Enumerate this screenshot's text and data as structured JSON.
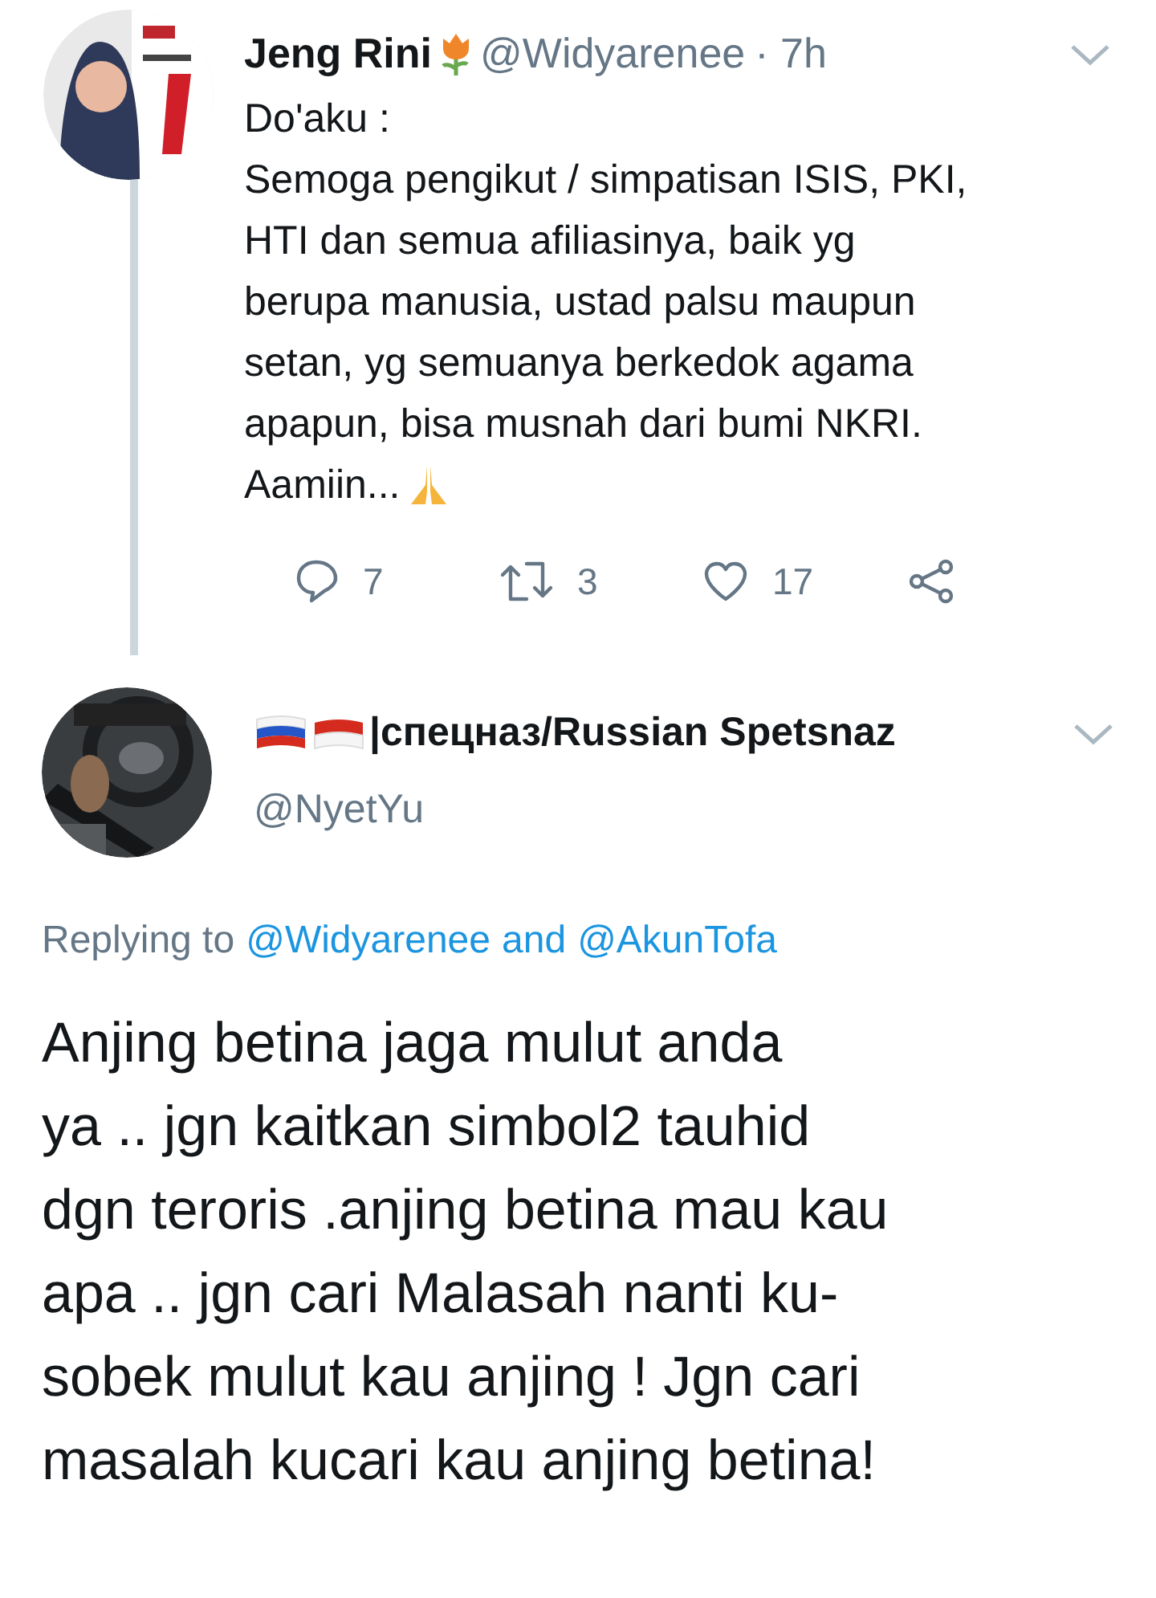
{
  "tweet": {
    "name": "Jeng Rini",
    "handle": "@Widyarenee",
    "time": "· 7h",
    "lines": [
      "Do'aku :",
      "Semoga pengikut / simpatisan ISIS, PKI,",
      "HTI dan semua afiliasinya, baik yg",
      "berupa manusia, ustad palsu maupun",
      "setan, yg semuanya berkedok agama",
      "apapun, bisa musnah dari bumi NKRI.",
      "Aamiin..."
    ],
    "actions": [
      {
        "kind": "reply",
        "count": "7"
      },
      {
        "kind": "retweet",
        "count": "3"
      },
      {
        "kind": "like",
        "count": "17"
      },
      {
        "kind": "share"
      }
    ]
  },
  "reply": {
    "name": "|спецназ/Russian Spetsnaz",
    "handle": "@NyetYu",
    "replying_to": [
      {
        "kind": "text",
        "text": "Replying to"
      },
      {
        "kind": "link",
        "text": "@Widyarenee"
      },
      {
        "kind": "link",
        "text": "and"
      },
      {
        "kind": "link",
        "text": "@AkunTofa"
      }
    ],
    "lines": [
      "Anjing betina jaga mulut anda",
      "ya .. jgn kaitkan simbol2 tauhid",
      "dgn teroris .anjing betina mau kau",
      "apa .. jgn cari Malasah nanti ku-",
      "sobek mulut kau anjing ! Jgn cari",
      "masalah kucari kau anjing betina!"
    ]
  }
}
